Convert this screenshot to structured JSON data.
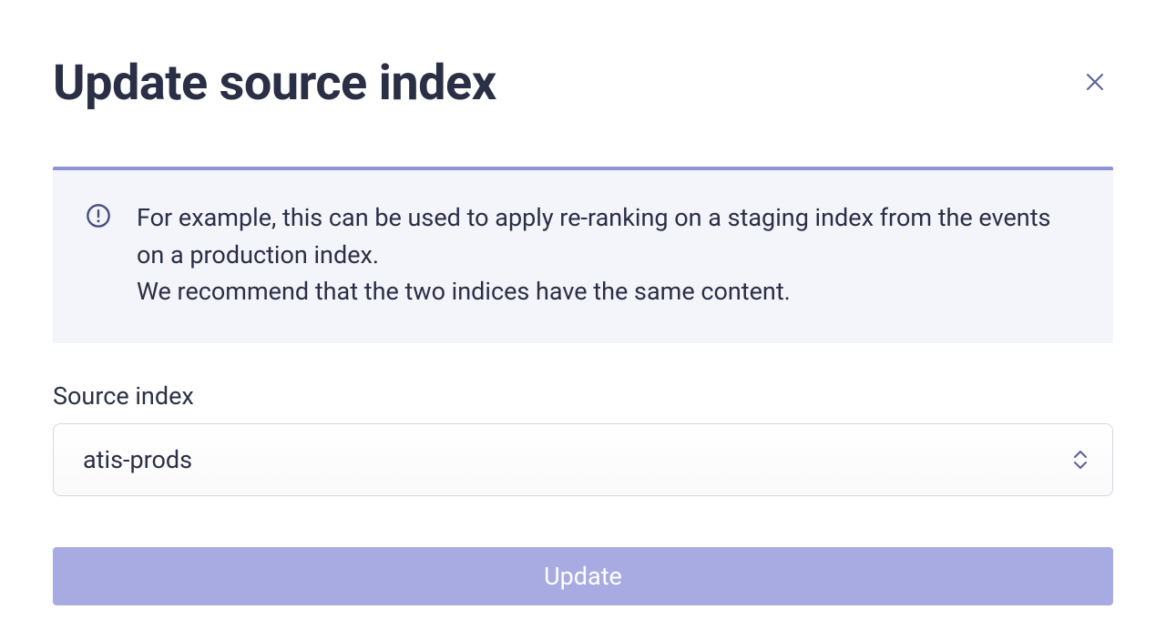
{
  "dialog": {
    "title": "Update source index",
    "info_line1": "For example, this can be used to apply re-ranking on a staging index from the events on a production index.",
    "info_line2": "We recommend that the two indices have the same content.",
    "field_label": "Source index",
    "selected_value": "atis-prods",
    "submit_label": "Update"
  }
}
